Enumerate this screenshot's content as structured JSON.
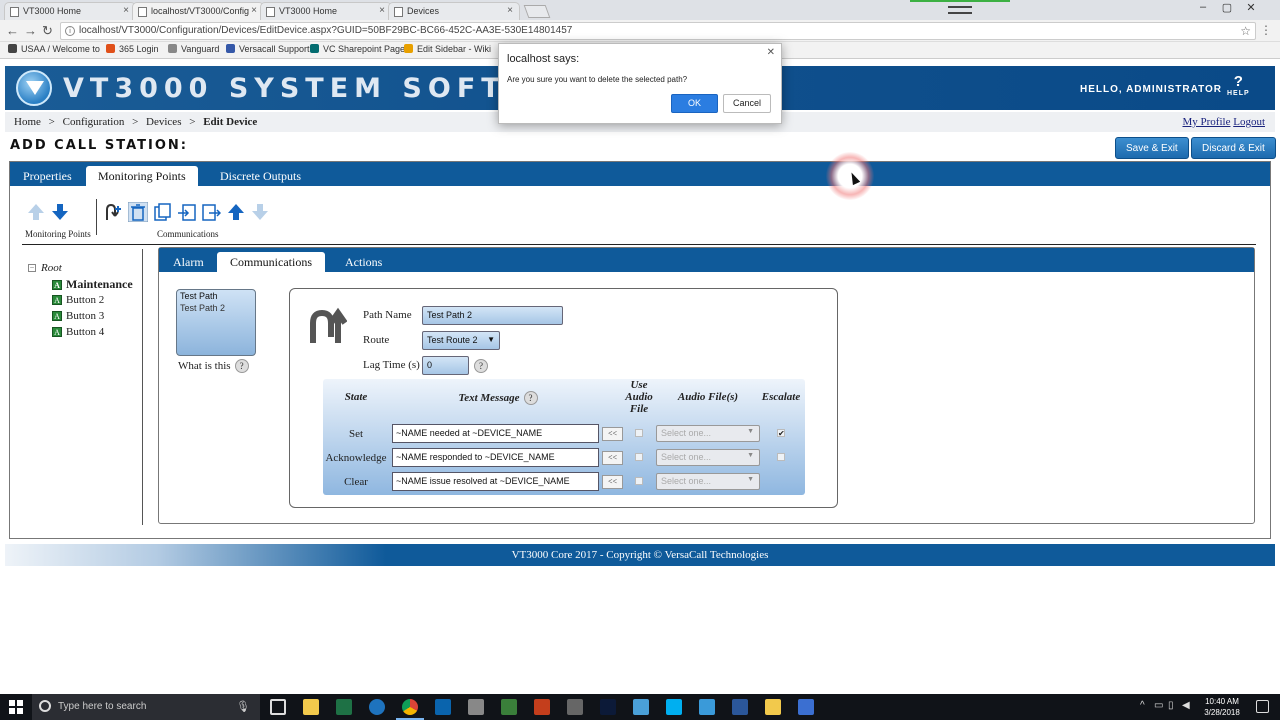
{
  "browser": {
    "tabs": [
      {
        "title": "VT3000 Home"
      },
      {
        "title": "localhost/VT3000/Config"
      },
      {
        "title": "VT3000 Home"
      },
      {
        "title": "Devices"
      }
    ],
    "url": "localhost/VT3000/Configuration/Devices/EditDevice.aspx?GUID=50BF29BC-BC66-452C-AA3E-530E14801457",
    "bookmarks": [
      {
        "label": "USAA / Welcome to",
        "color": "#444"
      },
      {
        "label": "365 Login",
        "color": "#e0501a"
      },
      {
        "label": "Vanguard",
        "color": "#888"
      },
      {
        "label": "Versacall Support",
        "color": "#3558a8"
      },
      {
        "label": "VC Sharepoint Page",
        "color": "#036c70"
      },
      {
        "label": "Edit Sidebar - Wiki",
        "color": "#e8a000"
      }
    ]
  },
  "header": {
    "app_title": "VT3000 System Software",
    "greeting": "Hello, Administrator",
    "help_label": "Help"
  },
  "breadcrumb": {
    "items": [
      "Home",
      "Configuration",
      "Devices"
    ],
    "current": "Edit Device",
    "separator": ">",
    "my_profile": "My Profile",
    "logout": "Logout"
  },
  "page": {
    "heading": "Add Call Station:",
    "save_exit": "Save & Exit",
    "discard_exit": "Discard & Exit"
  },
  "main_tabs": [
    "Properties",
    "Monitoring Points",
    "Discrete Outputs"
  ],
  "main_tabs_active": "Monitoring Points",
  "toolbar": {
    "monitoring_label": "Monitoring Points",
    "communications_label": "Communications"
  },
  "tree": {
    "root": "Root",
    "items": [
      "Maintenance",
      "Button 2",
      "Button 3",
      "Button 4"
    ],
    "selected": "Maintenance"
  },
  "inner_tabs": [
    "Alarm",
    "Communications",
    "Actions"
  ],
  "inner_tabs_active": "Communications",
  "paths": {
    "items": [
      "Test Path",
      "Test Path 2"
    ],
    "selected": "Test Path 2",
    "what_is_this": "What is this"
  },
  "form": {
    "path_name_label": "Path Name",
    "path_name_value": "Test Path 2",
    "route_label": "Route",
    "route_value": "Test Route 2",
    "lag_label": "Lag Time (s)",
    "lag_value": "0"
  },
  "grid": {
    "headers": {
      "state": "State",
      "text_message": "Text Message",
      "use_audio": "Use Audio File",
      "audio_files": "Audio File(s)",
      "escalate": "Escalate"
    },
    "arrow_label": "<<",
    "audio_placeholder": "Select one...",
    "rows": [
      {
        "state": "Set",
        "message": "~NAME needed at ~DEVICE_NAME",
        "escalate": true
      },
      {
        "state": "Acknowledge",
        "message": "~NAME responded to ~DEVICE_NAME",
        "escalate": false
      },
      {
        "state": "Clear",
        "message": "~NAME issue resolved at ~DEVICE_NAME",
        "escalate": false
      }
    ]
  },
  "footer": {
    "text": "VT3000 Core 2017  -  Copyright © VersaCall Technologies"
  },
  "dialog": {
    "title": "localhost says:",
    "message": "Are you sure you want to delete the selected path?",
    "ok": "OK",
    "cancel": "Cancel"
  },
  "taskbar": {
    "search_placeholder": "Type here to search",
    "time": "10:40 AM",
    "date": "3/28/2018",
    "apps": [
      {
        "name": "task-view",
        "color": "#101318"
      },
      {
        "name": "file-explorer",
        "color": "#f2c94c"
      },
      {
        "name": "excel",
        "color": "#1e7145"
      },
      {
        "name": "edge",
        "color": "#1e73be"
      },
      {
        "name": "chrome",
        "color": "#e0a020"
      },
      {
        "name": "outlook",
        "color": "#0a64ad"
      },
      {
        "name": "settings",
        "color": "#888"
      },
      {
        "name": "app-green",
        "color": "#3a7f3a"
      },
      {
        "name": "powerpoint",
        "color": "#c43e1c"
      },
      {
        "name": "snipping-tool",
        "color": "#666"
      },
      {
        "name": "photoshop",
        "color": "#0c1a38"
      },
      {
        "name": "network-app",
        "color": "#4aa0d8"
      },
      {
        "name": "skype",
        "color": "#00aff0"
      },
      {
        "name": "vpn-app",
        "color": "#3a9ad9"
      },
      {
        "name": "word",
        "color": "#2b579a"
      },
      {
        "name": "chat-app",
        "color": "#f2c94c"
      },
      {
        "name": "app-blue",
        "color": "#3b6fd1"
      }
    ]
  }
}
